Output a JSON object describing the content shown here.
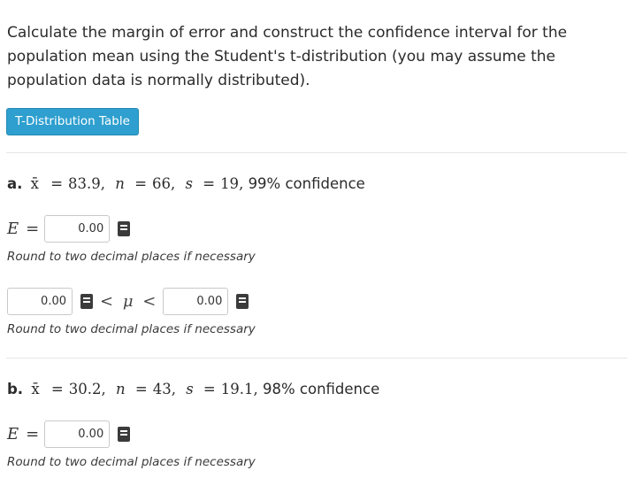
{
  "prompt": "Calculate the margin of error and construct the confidence interval for the population mean using the Student's t-distribution (you may assume the population data is normally distributed).",
  "tdist_button": "T-Distribution Table",
  "hint": "Round to two decimal places if necessary",
  "part_a": {
    "letter": "a.",
    "xbar_symbol": "x̄",
    "xbar": "83.9",
    "n": "66",
    "s": "19",
    "confidence": "99% confidence",
    "E_value": "0.00",
    "lower_value": "0.00",
    "upper_value": "0.00"
  },
  "part_b": {
    "letter": "b.",
    "xbar_symbol": "x̄",
    "xbar": "30.2",
    "n": "43",
    "s": "19.1",
    "confidence": "98% confidence",
    "E_value": "0.00"
  },
  "symbols": {
    "E": "E",
    "eq": "=",
    "lt": "<",
    "mu": "μ",
    "n": "n",
    "s": "s"
  },
  "icons": {
    "calculator": "book-icon"
  }
}
